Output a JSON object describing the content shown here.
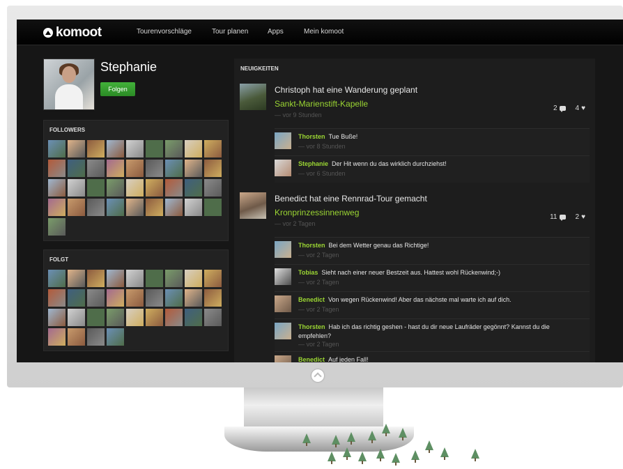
{
  "nav": {
    "logo": "komoot",
    "items": [
      "Tourenvorschläge",
      "Tour planen",
      "Apps",
      "Mein komoot"
    ]
  },
  "profile": {
    "name": "Stephanie",
    "follow_label": "Folgen"
  },
  "followers": {
    "title": "FOLLOWERS"
  },
  "following": {
    "title": "FOLGT"
  },
  "feed": {
    "title": "NEUIGKEITEN",
    "activities": [
      {
        "text": "Christoph hat eine Wanderung geplant",
        "tour": "Sankt-Marienstift-Kapelle",
        "time": "— vor 9 Stunden",
        "comments": "2",
        "likes": "4",
        "replies": [
          {
            "author": "Thorsten",
            "text": "Tue Buße!",
            "time": "— vor 8 Stunden"
          },
          {
            "author": "Stephanie",
            "text": "Der Hit wenn du das wirklich durchziehst!",
            "time": "— vor 6 Stunden"
          }
        ]
      },
      {
        "text": "Benedict hat eine Rennrad-Tour gemacht",
        "tour": "Kronprinzessinnenweg",
        "time": "— vor 2 Tagen",
        "comments": "11",
        "likes": "2",
        "replies": [
          {
            "author": "Thorsten",
            "text": "Bei dem Wetter genau das Richtige!",
            "time": "— vor 2 Tagen"
          },
          {
            "author": "Tobias",
            "text": "Sieht nach einer neuer Bestzeit aus. Hattest wohl Rückenwind;-)",
            "time": "— vor 2 Tagen"
          },
          {
            "author": "Benedict",
            "text": "Von wegen Rückenwind! Aber das nächste mal warte ich auf dich.",
            "time": "— vor 2 Tagen"
          },
          {
            "author": "Thorsten",
            "text": "Hab ich das richtig geshen - hast du dir neue Laufräder gegönnt? Kannst du die empfehlen?",
            "time": "— vor 2 Tagen"
          },
          {
            "author": "Benedict",
            "text": "Auf jeden Fall!",
            "time": ""
          }
        ]
      }
    ]
  },
  "colors": {
    "accent_green": "#9bd633",
    "button_green": "#2b8a25",
    "screen_bg": "#161616"
  }
}
